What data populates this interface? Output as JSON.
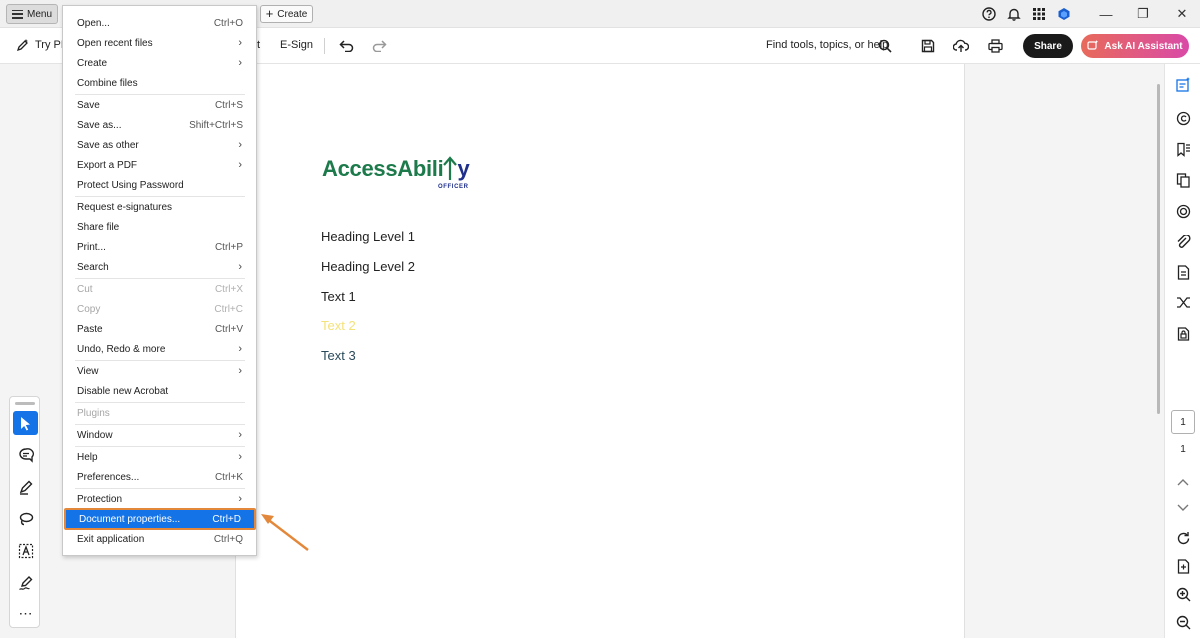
{
  "titlebar": {
    "menu_label": "Menu",
    "create_label": "Create",
    "colors": {
      "background": "#f0f0f0"
    }
  },
  "toolbar": {
    "try_pdf": "Try PD",
    "partial_tool": "t",
    "esign": "E-Sign",
    "find_tools": "Find tools, topics, or help",
    "share_label": "Share",
    "ai_assistant_label": "Ask AI Assistant",
    "colors": {
      "share_bg": "#1a1a1a",
      "ai_gradient_start": "#e86a5b",
      "ai_gradient_end": "#d94aa7"
    }
  },
  "menu": {
    "items": [
      {
        "label": "Open...",
        "shortcut": "Ctrl+O"
      },
      {
        "label": "Open recent files",
        "submenu": true
      },
      {
        "label": "Create",
        "submenu": true
      },
      {
        "label": "Combine files"
      },
      {
        "label": "Save",
        "shortcut": "Ctrl+S"
      },
      {
        "label": "Save as...",
        "shortcut": "Shift+Ctrl+S"
      },
      {
        "label": "Save as other",
        "submenu": true
      },
      {
        "label": "Export a PDF",
        "submenu": true
      },
      {
        "label": "Protect Using Password"
      },
      {
        "label": "Request e-signatures"
      },
      {
        "label": "Share file"
      },
      {
        "label": "Print...",
        "shortcut": "Ctrl+P"
      },
      {
        "label": "Search",
        "submenu": true
      },
      {
        "label": "Cut",
        "shortcut": "Ctrl+X",
        "disabled": true
      },
      {
        "label": "Copy",
        "shortcut": "Ctrl+C",
        "disabled": true
      },
      {
        "label": "Paste",
        "shortcut": "Ctrl+V"
      },
      {
        "label": "Undo, Redo & more",
        "submenu": true
      },
      {
        "label": "View",
        "submenu": true
      },
      {
        "label": "Disable new Acrobat"
      },
      {
        "label": "Plugins",
        "disabled": true
      },
      {
        "label": "Window",
        "submenu": true
      },
      {
        "label": "Help",
        "submenu": true
      },
      {
        "label": "Preferences...",
        "shortcut": "Ctrl+K"
      },
      {
        "label": "Protection",
        "submenu": true
      },
      {
        "label": "Document properties...",
        "shortcut": "Ctrl+D",
        "highlighted": true
      },
      {
        "label": "Exit application",
        "shortcut": "Ctrl+Q"
      }
    ],
    "submenu_glyph": "›",
    "colors": {
      "highlight": "#1473e6",
      "annotation": "#e3883a",
      "disabled_text": "#a6a6a6"
    }
  },
  "document": {
    "logo": {
      "main": "AccessAbili",
      "tail": "y",
      "subtitle": "OFFICER",
      "colors": {
        "green": "#1c7a4b",
        "navy": "#1f2f8c"
      }
    },
    "lines": [
      {
        "text": "Heading Level 1",
        "color": "#222222"
      },
      {
        "text": "Heading Level 2",
        "color": "#222222"
      },
      {
        "text": "Text 1",
        "color": "#222222"
      },
      {
        "text": "Text 2",
        "color": "#f3e27a"
      },
      {
        "text": "Text 3",
        "color": "#2a4a5a"
      }
    ]
  },
  "page_nav": {
    "current_page": "1",
    "total_pages": "1"
  },
  "icons": {
    "titlebar": [
      "help-icon",
      "bell-icon",
      "apps-grid-icon",
      "user-avatar-icon"
    ],
    "window": [
      "minimize-icon",
      "restore-icon",
      "close-icon"
    ],
    "toolbar": [
      "undo-icon",
      "redo-icon",
      "search-icon",
      "save-icon",
      "upload-icon",
      "print-icon"
    ],
    "left_tools": [
      "select-pointer-icon",
      "add-comment-icon",
      "highlight-pen-icon",
      "draw-lasso-icon",
      "text-box-icon",
      "fill-sign-icon",
      "more-tools-icon"
    ],
    "right_rail": [
      "edit-pdf-icon",
      "comment-icon",
      "bookmark-icon",
      "pages-icon",
      "redact-icon",
      "attachment-icon",
      "export-icon",
      "compare-icon",
      "protect-icon",
      "scroll-up-icon",
      "scroll-down-icon",
      "rotate-icon",
      "page-fit-icon",
      "zoom-in-icon",
      "zoom-out-icon"
    ]
  },
  "window_glyphs": {
    "minimize": "—",
    "restore": "❐",
    "close": "✕"
  },
  "glyphs": {
    "create_plus": "+",
    "more_tools": "⋯"
  }
}
